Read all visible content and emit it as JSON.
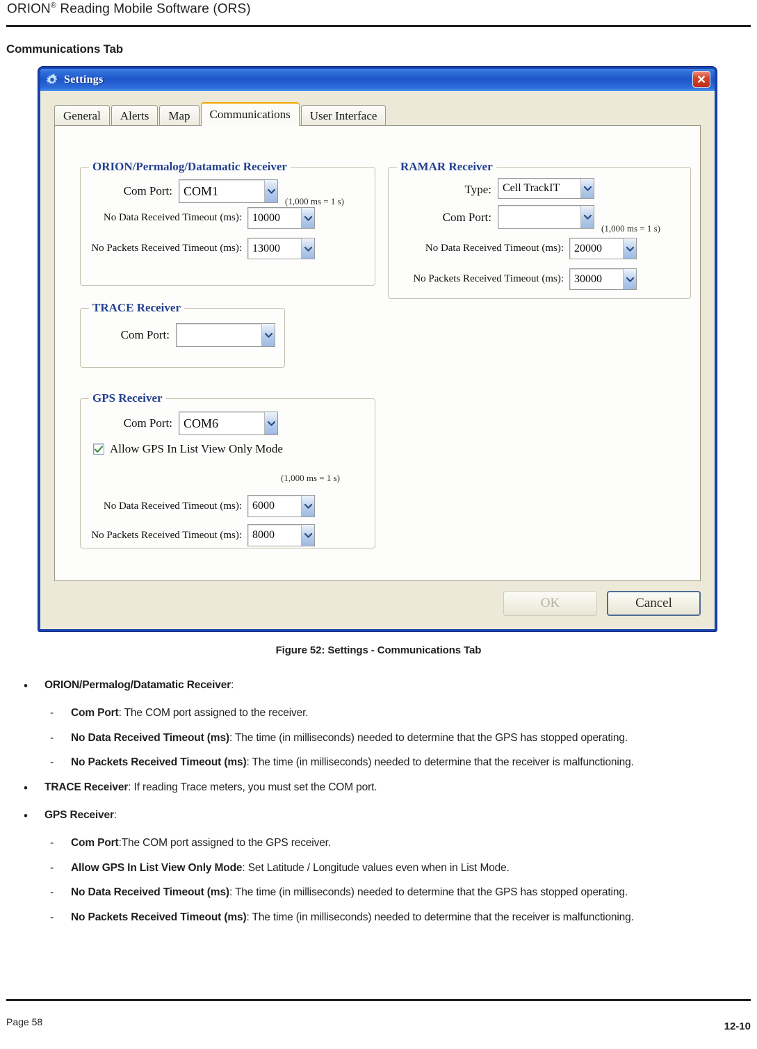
{
  "page": {
    "header_title": "ORION® Reading Mobile Software (ORS)",
    "header_title_main": "ORION",
    "header_title_sup": "®",
    "header_title_rest": " Reading Mobile Software (ORS)",
    "section_heading": "Communications Tab",
    "figure_caption": "Figure 52:  Settings - Communications Tab",
    "footer_left": "Page 58",
    "footer_right": "12-10"
  },
  "dialog": {
    "title": "Settings",
    "icon": "gear-icon",
    "close_icon": "close-icon",
    "tabs": [
      {
        "label": "General",
        "active": false
      },
      {
        "label": "Alerts",
        "active": false
      },
      {
        "label": "Map",
        "active": false
      },
      {
        "label": "Communications",
        "active": true
      },
      {
        "label": "User Interface",
        "active": false
      }
    ],
    "groups": {
      "orion": {
        "legend": "ORION/Permalog/Datamatic Receiver",
        "com_port_label": "Com Port:",
        "com_port_value": "COM1",
        "ms_note": "(1,000 ms = 1 s)",
        "no_data_label": "No Data Received Timeout (ms):",
        "no_data_value": "10000",
        "no_packets_label": "No Packets Received Timeout (ms):",
        "no_packets_value": "13000"
      },
      "ramar": {
        "legend": "RAMAR Receiver",
        "type_label": "Type:",
        "type_value": "Cell TrackIT",
        "com_port_label": "Com Port:",
        "com_port_value": "",
        "ms_note": "(1,000 ms = 1 s)",
        "no_data_label": "No Data Received Timeout (ms):",
        "no_data_value": "20000",
        "no_packets_label": "No Packets Received Timeout (ms):",
        "no_packets_value": "30000"
      },
      "trace": {
        "legend": "TRACE Receiver",
        "com_port_label": "Com Port:",
        "com_port_value": ""
      },
      "gps": {
        "legend": "GPS Receiver",
        "com_port_label": "Com Port:",
        "com_port_value": "COM6",
        "allow_gps_label": "Allow GPS In List View Only Mode",
        "allow_gps_checked": true,
        "ms_note": "(1,000 ms = 1 s)",
        "no_data_label": "No Data Received Timeout (ms):",
        "no_data_value": "6000",
        "no_packets_label": "No Packets Received Timeout (ms):",
        "no_packets_value": "8000"
      }
    },
    "buttons": {
      "ok_label": "OK",
      "ok_disabled": true,
      "cancel_label": "Cancel"
    },
    "colors": {
      "titlebar_blue": "#1f55c8",
      "window_border": "#1b44b0",
      "client_bg": "#ece9d8",
      "panel_bg": "#fdfdfb",
      "legend_text": "#23418f",
      "active_tab_accent": "#f0a500",
      "close_button_red": "#bf2b14"
    }
  },
  "body_list": [
    {
      "kind": "bullet",
      "marker": "•",
      "bold": "ORION/Permalog/Datamatic Receiver",
      "rest": ":"
    },
    {
      "kind": "dash",
      "marker": "-",
      "bold": "Com Port",
      "rest": ":  The COM port assigned to the receiver."
    },
    {
      "kind": "dash",
      "marker": "-",
      "bold": "No Data Received Timeout (ms)",
      "rest": ":  The time (in milliseconds) needed to determine that the GPS has stopped operating."
    },
    {
      "kind": "dash",
      "marker": "-",
      "bold": "No Packets Received Timeout (ms)",
      "rest": ":  The time (in milliseconds) needed to determine that the receiver is malfunctioning."
    },
    {
      "kind": "bullet",
      "marker": "•",
      "bold": "TRACE Receiver",
      "rest": ":  If reading Trace meters, you must set the COM port."
    },
    {
      "kind": "bullet",
      "marker": "•",
      "bold": "GPS Receiver",
      "rest": ":"
    },
    {
      "kind": "dash",
      "marker": "-",
      "bold": "Com Port",
      "rest": ":The COM port assigned to the GPS receiver."
    },
    {
      "kind": "dash",
      "marker": "-",
      "bold": "Allow GPS In List View Only Mode",
      "rest": ":  Set Latitude / Longitude values even when in List Mode."
    },
    {
      "kind": "dash",
      "marker": "-",
      "bold": "No Data Received Timeout (ms)",
      "rest": ":  The time (in milliseconds) needed to determine that the GPS has stopped operating."
    },
    {
      "kind": "dash",
      "marker": "-",
      "bold": "No Packets Received Timeout (ms)",
      "rest": ":  The time (in milliseconds) needed to determine that the receiver is malfunctioning."
    }
  ]
}
